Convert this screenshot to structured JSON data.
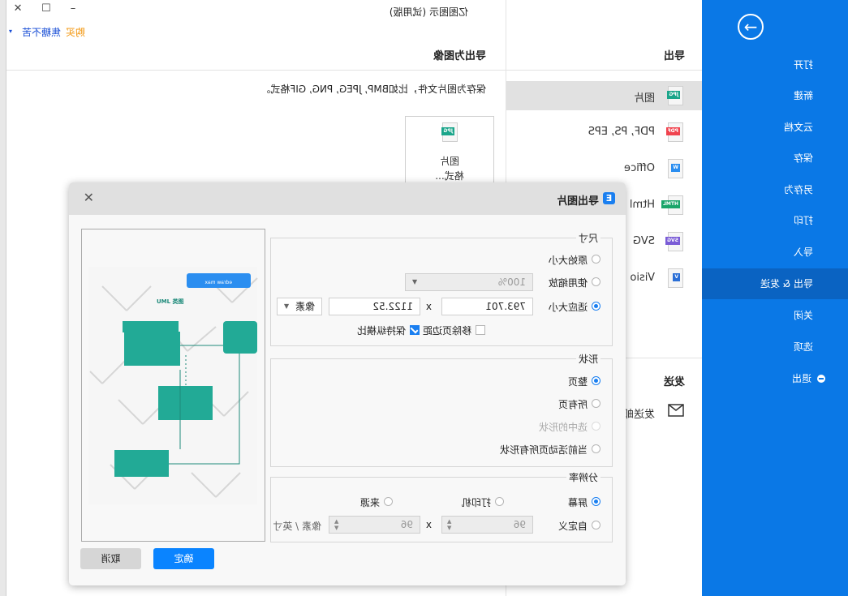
{
  "window": {
    "title": "亿图图示 (试用版)",
    "controls": {
      "minimize": "–",
      "maximize": "☐",
      "close": "✕"
    },
    "buy_label": "购买",
    "user_name": "焦糖不苦",
    "user_caret": "▾"
  },
  "sidebar": {
    "back_icon": "→",
    "items": [
      {
        "label": "打开"
      },
      {
        "label": "新建"
      },
      {
        "label": "云文档"
      },
      {
        "label": "保存"
      },
      {
        "label": "另存为"
      },
      {
        "label": "打印"
      },
      {
        "label": "导入"
      },
      {
        "label": "导出 & 发送",
        "active": true
      },
      {
        "label": "关闭"
      },
      {
        "label": "选项"
      },
      {
        "label": "退出",
        "icon": "minus-circle-icon"
      }
    ],
    "accent_color": "#0a78e6"
  },
  "export_menu": {
    "title": "导出",
    "items": [
      {
        "label": "图片",
        "tag": "JPG",
        "tag_color": "#1aa58a",
        "active": true
      },
      {
        "label": "PDF, PS, EPS",
        "tag": "PDF",
        "tag_color": "#f0434e"
      },
      {
        "label": "Office",
        "tag": "W",
        "tag_color": "#2b8ef0"
      },
      {
        "label": "Html",
        "tag": "HTML",
        "tag_color": "#1aa56a"
      },
      {
        "label": "SVG",
        "tag": "SVG",
        "tag_color": "#7a5cd6"
      },
      {
        "label": "Visio",
        "tag": "V",
        "tag_color": "#2b6fd6"
      }
    ],
    "send_title": "发送",
    "send_items": [
      {
        "label": "发送邮件",
        "icon": "mail-icon"
      }
    ]
  },
  "content": {
    "title": "导出为图像",
    "description": "保存为图片文件，比如BMP, JPEG, PNG, GIF格式。",
    "card": {
      "tag": "JPG",
      "line1": "图片",
      "line2": "格式..."
    }
  },
  "dialog": {
    "title": "导出图片",
    "icon_letter": "E",
    "close_icon": "✕",
    "size": {
      "legend": "尺寸",
      "options": [
        {
          "label": "原始大小",
          "selected": false
        },
        {
          "label": "使用缩放",
          "selected": false
        },
        {
          "label": "适应大小",
          "selected": true
        }
      ],
      "zoom_value": "100%",
      "width": "793.701",
      "height": "1122.52",
      "x_sep": "x",
      "unit": "像素",
      "remove_margin": {
        "label": "移除页边距",
        "checked": false
      },
      "keep_ratio": {
        "label": "保持纵横比",
        "checked": true
      }
    },
    "shape": {
      "legend": "形状",
      "options": [
        {
          "label": "整页",
          "selected": true
        },
        {
          "label": "所有页",
          "selected": false
        },
        {
          "label": "选中的形状",
          "selected": false,
          "disabled": true
        },
        {
          "label": "当前活动页所有形状",
          "selected": false
        }
      ]
    },
    "resolution": {
      "legend": "分辨率",
      "options": [
        {
          "label": "屏幕",
          "selected": true
        },
        {
          "label": "打印机",
          "selected": false
        },
        {
          "label": "来源",
          "selected": false
        },
        {
          "label": "自定义",
          "selected": false
        }
      ],
      "dpi_x": "96",
      "dpi_y": "96",
      "x_sep": "x",
      "unit": "像素 / 英寸"
    },
    "preview": {
      "banner": "edraw max",
      "diagram_title": "UML 类图",
      "watermark": "edraw max",
      "shape_color": "#22aa96"
    },
    "ok_label": "确定",
    "cancel_label": "取消"
  }
}
